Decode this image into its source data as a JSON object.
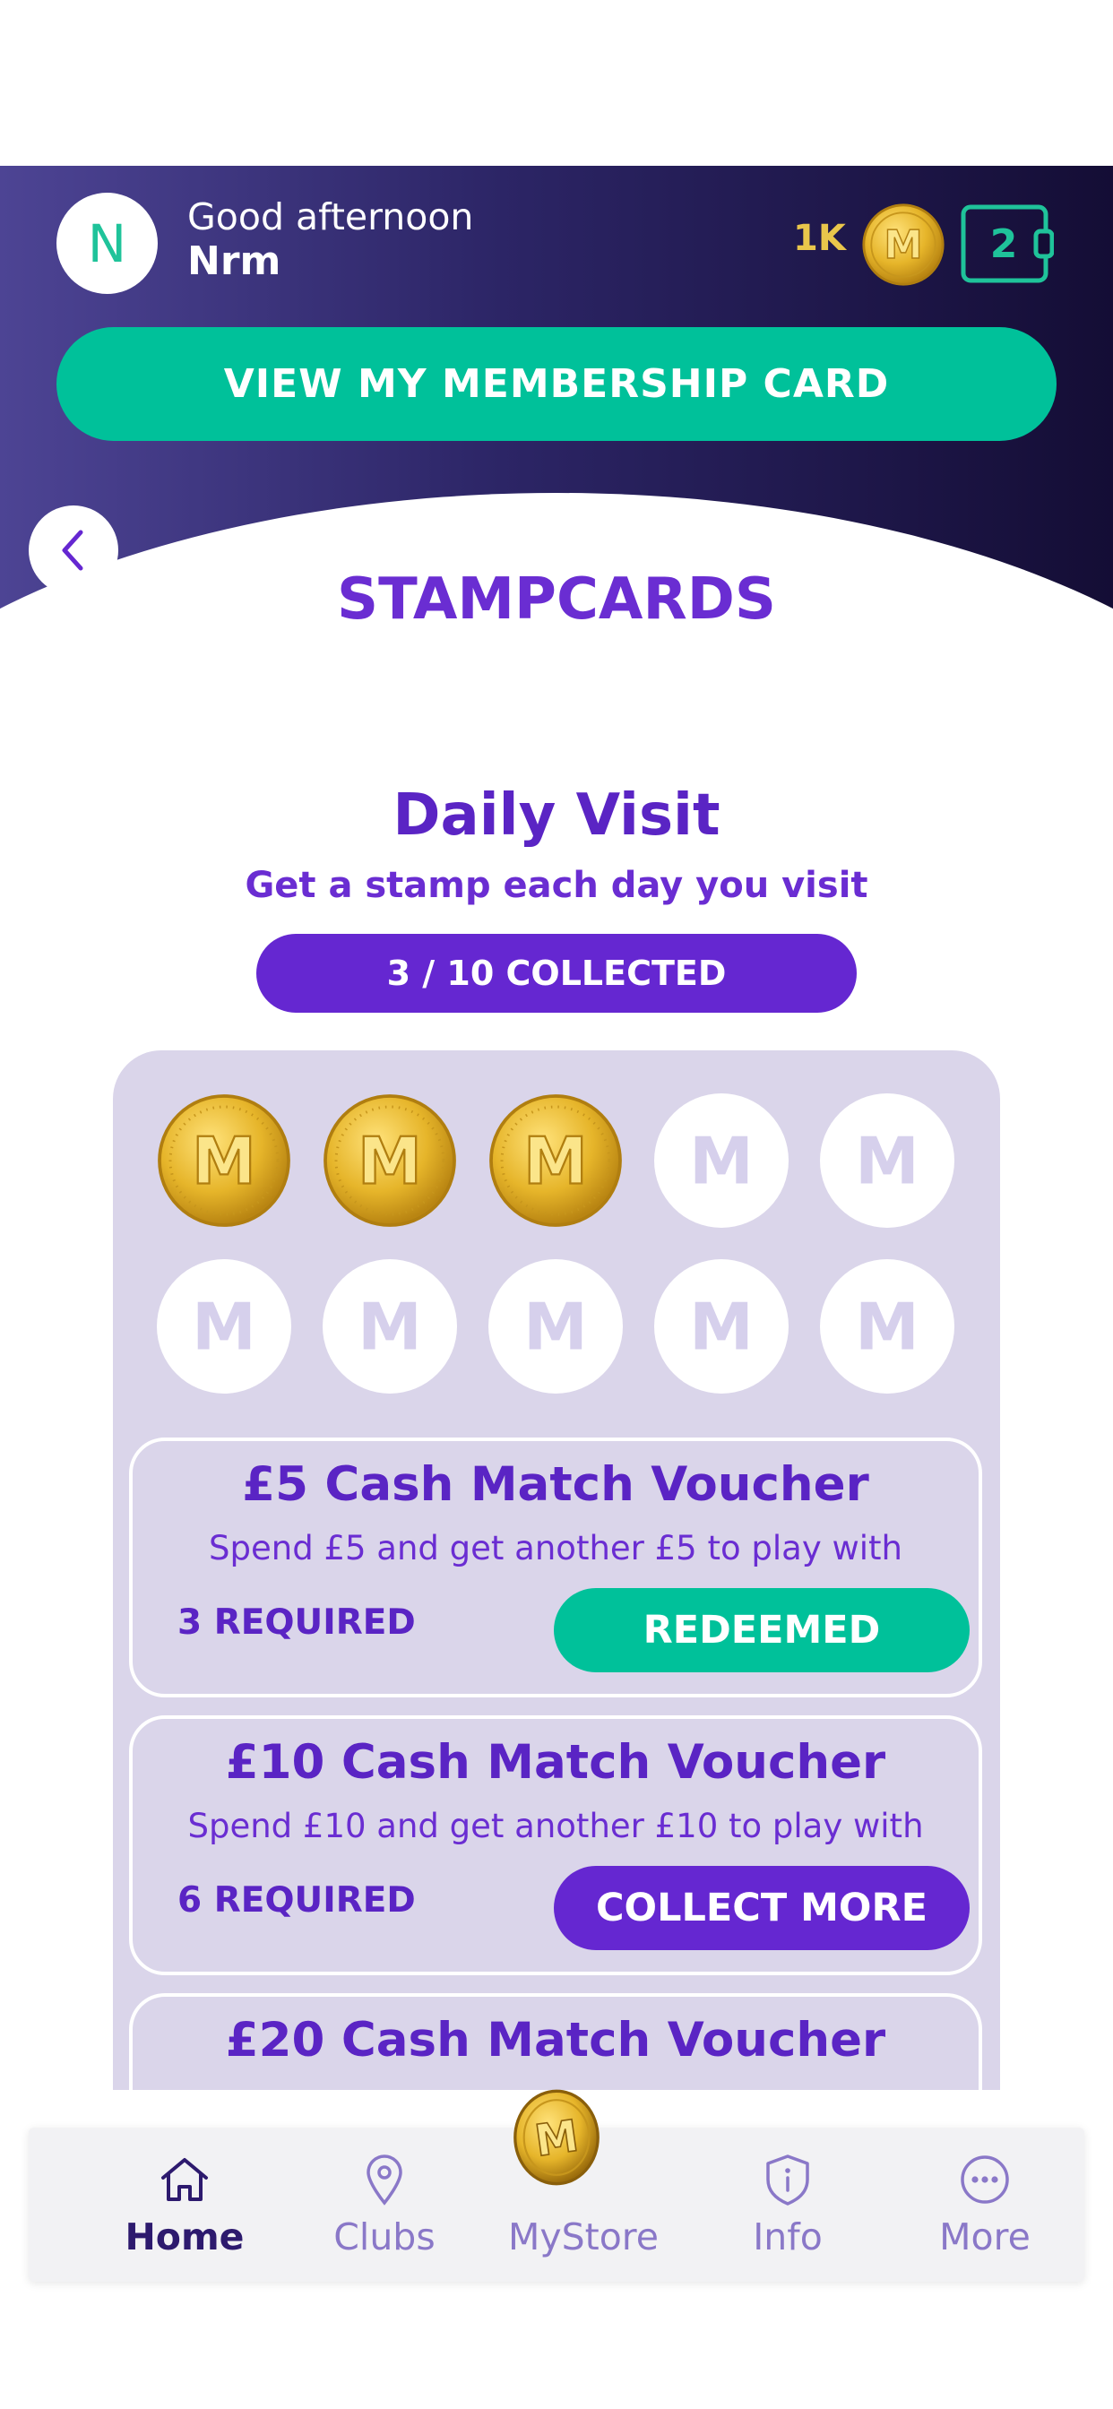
{
  "header": {
    "avatar_initial": "N",
    "greeting": "Good afternoon",
    "username": "Nrm",
    "points": "1K",
    "coin_icon": "m-coin-icon",
    "wallet_icon": "wallet-icon",
    "wallet_count": "2",
    "membership_button": "VIEW MY MEMBERSHIP CARD"
  },
  "page": {
    "back_icon": "chevron-left-icon",
    "title": "STAMPCARDS"
  },
  "stampcard": {
    "title": "Daily Visit",
    "subtitle": "Get a stamp each day you visit",
    "progress_label": "3 / 10 COLLECTED",
    "collected": 3,
    "total": 10,
    "stamp_letter": "M"
  },
  "vouchers": [
    {
      "title": "£5 Cash Match Voucher",
      "description": "Spend £5 and get another £5 to play with",
      "required": "3 REQUIRED",
      "button": "REDEEMED",
      "state": "redeemed"
    },
    {
      "title": "£10 Cash Match Voucher",
      "description": "Spend £10 and get another £10 to play with",
      "required": "6 REQUIRED",
      "button": "COLLECT MORE",
      "state": "collect"
    },
    {
      "title": "£20 Cash Match Voucher"
    }
  ],
  "nav": {
    "items": [
      {
        "label": "Home",
        "icon": "home-icon",
        "active": true
      },
      {
        "label": "Clubs",
        "icon": "map-pin-icon",
        "active": false
      },
      {
        "label": "MyStore",
        "icon": "m-coin-icon",
        "active": false
      },
      {
        "label": "Info",
        "icon": "info-shield-icon",
        "active": false
      },
      {
        "label": "More",
        "icon": "more-dots-icon",
        "active": false
      }
    ]
  },
  "colors": {
    "accent_purple": "#6527d1",
    "accent_green": "#00c19a",
    "coin_gold": "#e9b92c",
    "header_dark": "#140d35"
  }
}
